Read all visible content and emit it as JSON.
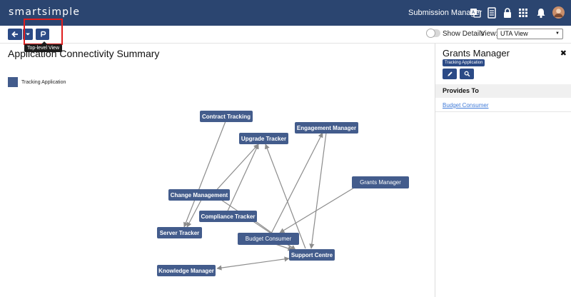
{
  "header": {
    "brand": "smartsimple",
    "submission_manager": "Submission Manager",
    "icons": [
      "translate-icon",
      "document-icon",
      "lock-icon",
      "grid-icon",
      "bell-icon",
      "avatar"
    ]
  },
  "toolbar": {
    "tooltip": "Top-level View",
    "show_details": "Show Details",
    "view_label": "View:",
    "view_value": "UTA View"
  },
  "main": {
    "title": "Application Connectivity Summary",
    "legend": "Tracking Application",
    "nodes": {
      "contract_tracking": "Contract Tracking",
      "upgrade_tracker": "Upgrade Tracker",
      "engagement_manager": "Engagement Manager",
      "grants_manager": "Grants Manager",
      "change_management": "Change Management",
      "compliance_tracker": "Compliance Tracker",
      "server_tracker": "Server Tracker",
      "budget_consumer": "Budget Consumer",
      "support_centre": "Support Centre",
      "knowledge_manager": "Knowledge Manager"
    }
  },
  "panel": {
    "title": "Grants Manager",
    "badge": "Tracking Application",
    "section": "Provides To",
    "link": "Budget Consumer"
  },
  "colors": {
    "nav": "#2b4570",
    "node": "#435c8c",
    "button": "#2b4a86",
    "edge": "#8c8c8c",
    "highlight": "#e01e1e"
  }
}
